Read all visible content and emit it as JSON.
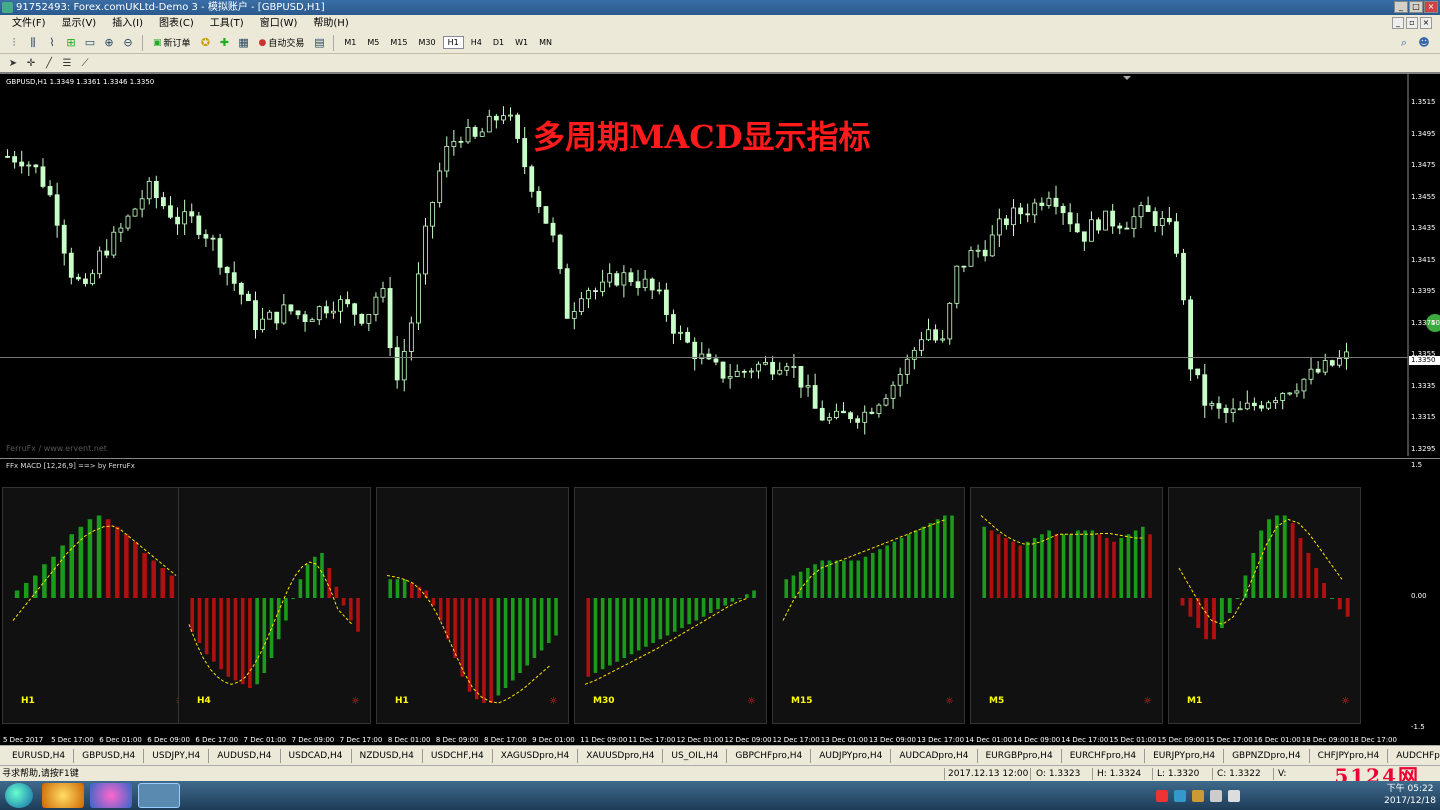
{
  "window": {
    "title": "91752493: Forex.comUKLtd-Demo 3 - 模拟账户 - [GBPUSD,H1]"
  },
  "menu": {
    "items": [
      "文件(F)",
      "显示(V)",
      "插入(I)",
      "图表(C)",
      "工具(T)",
      "窗口(W)",
      "帮助(H)"
    ]
  },
  "toolbar": {
    "new_order_label": "新订单",
    "auto_trading_label": "自动交易",
    "timeframes": [
      "M1",
      "M5",
      "M15",
      "M30",
      "H1",
      "H4",
      "D1",
      "W1",
      "MN"
    ],
    "active_timeframe": "H1"
  },
  "chart": {
    "header": "GBPUSD,H1  1.3349 1.3361 1.3346 1.3350",
    "title_overlay": "多周期MACD显示指标",
    "watermark": "FerruFx / www.ervent.net",
    "current_price": "1.3350",
    "badge_text": "40",
    "price_axis": [
      "1.3515",
      "1.3495",
      "1.3475",
      "1.3455",
      "1.3435",
      "1.3415",
      "1.3395",
      "1.3375",
      "1.3355",
      "1.3335",
      "1.3315",
      "1.3295"
    ],
    "colors": {
      "bull": "#b8ffb8",
      "bear": "#ffffff",
      "background": "#000000",
      "grid": "#555555"
    }
  },
  "chart_data": {
    "type": "candlestick",
    "symbol": "GBPUSD",
    "timeframe": "H1",
    "ylim": [
      1.329,
      1.352
    ],
    "close_approx": [
      1.3475,
      1.3474,
      1.3465,
      1.3445,
      1.3405,
      1.339,
      1.3415,
      1.3425,
      1.344,
      1.3455,
      1.3445,
      1.3435,
      1.3435,
      1.3425,
      1.3405,
      1.339,
      1.337,
      1.3375,
      1.338,
      1.3375,
      1.338,
      1.3385,
      1.338,
      1.3375,
      1.3395,
      1.3335,
      1.3375,
      1.3435,
      1.3475,
      1.349,
      1.3485,
      1.3495,
      1.3505,
      1.3475,
      1.345,
      1.3425,
      1.3375,
      1.3395,
      1.339,
      1.34,
      1.34,
      1.3395,
      1.3385,
      1.3365,
      1.3355,
      1.3345,
      1.334,
      1.334,
      1.3345,
      1.3345,
      1.335,
      1.3335,
      1.3315,
      1.331,
      1.3315,
      1.3315,
      1.3325,
      1.3335,
      1.335,
      1.337,
      1.3355,
      1.3405,
      1.3415,
      1.342,
      1.3435,
      1.344,
      1.3445,
      1.3455,
      1.344,
      1.3425,
      1.3435,
      1.3435,
      1.3435,
      1.344,
      1.3435,
      1.3425,
      1.3345,
      1.332,
      1.3315,
      1.3315,
      1.332,
      1.3325,
      1.333,
      1.3335,
      1.334,
      1.3345,
      1.335
    ]
  },
  "macd": {
    "indicator_label": "FFx MACD [12,26,9] ==> by FerruFx",
    "axis": [
      "1.5",
      "0.00",
      "-1.5"
    ],
    "panels": [
      {
        "tf": "H1",
        "hist": [
          0.1,
          0.2,
          0.3,
          0.45,
          0.55,
          0.7,
          0.85,
          0.95,
          1.05,
          1.1,
          1.05,
          0.95,
          0.85,
          0.75,
          0.6,
          0.5,
          0.4,
          0.3,
          0.2
        ],
        "signal": [
          -0.3,
          -0.15,
          0.0,
          0.15,
          0.3,
          0.45,
          0.6,
          0.72,
          0.83,
          0.9,
          0.95,
          0.96,
          0.9,
          0.8,
          0.7,
          0.6,
          0.5,
          0.4,
          0.3
        ]
      },
      {
        "tf": "H4",
        "hist": [
          -0.45,
          -0.6,
          -0.75,
          -0.85,
          -0.95,
          -1.05,
          -1.1,
          -1.15,
          -1.2,
          -1.15,
          -1.0,
          -0.8,
          -0.55,
          -0.3,
          0.0,
          0.25,
          0.45,
          0.55,
          0.6,
          0.4,
          0.15,
          -0.1,
          -0.3,
          -0.45
        ],
        "signal": [
          -0.35,
          -0.6,
          -0.8,
          -0.95,
          -1.05,
          -1.12,
          -1.15,
          -1.12,
          -1.05,
          -0.92,
          -0.75,
          -0.55,
          -0.32,
          -0.1,
          0.12,
          0.3,
          0.42,
          0.48,
          0.45,
          0.3,
          0.1,
          -0.15,
          -0.25,
          -0.35
        ]
      },
      {
        "tf": "H1",
        "hist": [
          0.25,
          0.25,
          0.25,
          0.2,
          0.15,
          0.1,
          -0.1,
          -0.3,
          -0.55,
          -0.8,
          -1.05,
          -1.25,
          -1.35,
          -1.4,
          -1.4,
          -1.3,
          -1.2,
          -1.1,
          -1.0,
          -0.9,
          -0.8,
          -0.7,
          -0.6,
          -0.5
        ],
        "signal": [
          0.3,
          0.28,
          0.25,
          0.2,
          0.1,
          -0.05,
          -0.25,
          -0.5,
          -0.75,
          -1.0,
          -1.2,
          -1.32,
          -1.38,
          -1.4,
          -1.35,
          -1.28,
          -1.2,
          -1.1,
          -1.0,
          -0.9
        ]
      },
      {
        "tf": "M30",
        "hist": [
          -1.05,
          -1.0,
          -0.95,
          -0.9,
          -0.85,
          -0.8,
          -0.75,
          -0.7,
          -0.65,
          -0.6,
          -0.55,
          -0.5,
          -0.45,
          -0.4,
          -0.35,
          -0.3,
          -0.25,
          -0.2,
          -0.15,
          -0.1,
          -0.05,
          0.0,
          0.05,
          0.1
        ],
        "signal": [
          -1.15,
          -1.1,
          -1.03,
          -0.96,
          -0.89,
          -0.82,
          -0.75,
          -0.68,
          -0.6,
          -0.52,
          -0.44,
          -0.36,
          -0.28,
          -0.2,
          -0.12,
          -0.05,
          0.0
        ]
      },
      {
        "tf": "M15",
        "hist": [
          0.25,
          0.3,
          0.35,
          0.4,
          0.45,
          0.5,
          0.5,
          0.5,
          0.5,
          0.5,
          0.5,
          0.55,
          0.6,
          0.65,
          0.7,
          0.75,
          0.8,
          0.85,
          0.9,
          0.95,
          1.0,
          1.05,
          1.1,
          1.1
        ],
        "signal": [
          -0.3,
          -0.05,
          0.15,
          0.3,
          0.4,
          0.45,
          0.5,
          0.55,
          0.6,
          0.65,
          0.7,
          0.75,
          0.8,
          0.85,
          0.9,
          0.95,
          1.0,
          1.05
        ]
      },
      {
        "tf": "M5",
        "hist": [
          0.95,
          0.9,
          0.85,
          0.8,
          0.75,
          0.7,
          0.75,
          0.8,
          0.85,
          0.9,
          0.85,
          0.85,
          0.85,
          0.9,
          0.9,
          0.9,
          0.85,
          0.8,
          0.75,
          0.8,
          0.85,
          0.9,
          0.95,
          0.85
        ],
        "signal": [
          1.1,
          1.0,
          0.9,
          0.82,
          0.76,
          0.72,
          0.72,
          0.75,
          0.8,
          0.85,
          0.85,
          0.85,
          0.85,
          0.85,
          0.86,
          0.86,
          0.84,
          0.82,
          0.8,
          0.8
        ]
      },
      {
        "tf": "M1",
        "hist": [
          -0.1,
          -0.25,
          -0.4,
          -0.55,
          -0.55,
          -0.4,
          -0.2,
          0.0,
          0.3,
          0.6,
          0.9,
          1.05,
          1.1,
          1.1,
          1.0,
          0.8,
          0.6,
          0.4,
          0.2,
          0.0,
          -0.15,
          -0.25
        ],
        "signal": [
          0.4,
          0.15,
          -0.1,
          -0.3,
          -0.35,
          -0.25,
          0.0,
          0.35,
          0.7,
          0.95,
          1.05,
          1.0,
          0.85,
          0.65,
          0.45,
          0.25
        ]
      }
    ]
  },
  "time_axis": [
    "5 Dec 2017",
    "5 Dec 17:00",
    "6 Dec 01:00",
    "6 Dec 09:00",
    "6 Dec 17:00",
    "7 Dec 01:00",
    "7 Dec 09:00",
    "7 Dec 17:00",
    "8 Dec 01:00",
    "8 Dec 09:00",
    "8 Dec 17:00",
    "9 Dec 01:00",
    "11 Dec 09:00",
    "11 Dec 17:00",
    "12 Dec 01:00",
    "12 Dec 09:00",
    "12 Dec 17:00",
    "13 Dec 01:00",
    "13 Dec 09:00",
    "13 Dec 17:00",
    "14 Dec 01:00",
    "14 Dec 09:00",
    "14 Dec 17:00",
    "15 Dec 01:00",
    "15 Dec 09:00",
    "15 Dec 17:00",
    "16 Dec 01:00",
    "18 Dec 09:00",
    "18 Dec 17:00"
  ],
  "symbol_tabs": [
    "EURUSD,H4",
    "GBPUSD,H4",
    "USDJPY,H4",
    "AUDUSD,H4",
    "USDCAD,H4",
    "NZDUSD,H4",
    "USDCHF,H4",
    "XAGUSDpro,H4",
    "XAUUSDpro,H4",
    "US_OIL,H4",
    "GBPCHFpro,H4",
    "AUDJPYpro,H4",
    "AUDCADpro,H4",
    "EURGBPpro,H4",
    "EURCHFpro,H4",
    "EURJPYpro,H4",
    "GBPNZDpro,H4",
    "CHFJPYpro,H4",
    "AUDCHFp"
  ],
  "status": {
    "help": "寻求帮助,请按F1键",
    "datetime": "2017.12.13 12:00",
    "open": "O: 1.3323",
    "high": "H: 1.3324",
    "low": "L: 1.3320",
    "close": "C: 1.3322",
    "v": "V:"
  },
  "taskbar": {
    "clock_time": "下午 05:22",
    "clock_date": "2017/12/18",
    "brand_logo": "5124网"
  }
}
